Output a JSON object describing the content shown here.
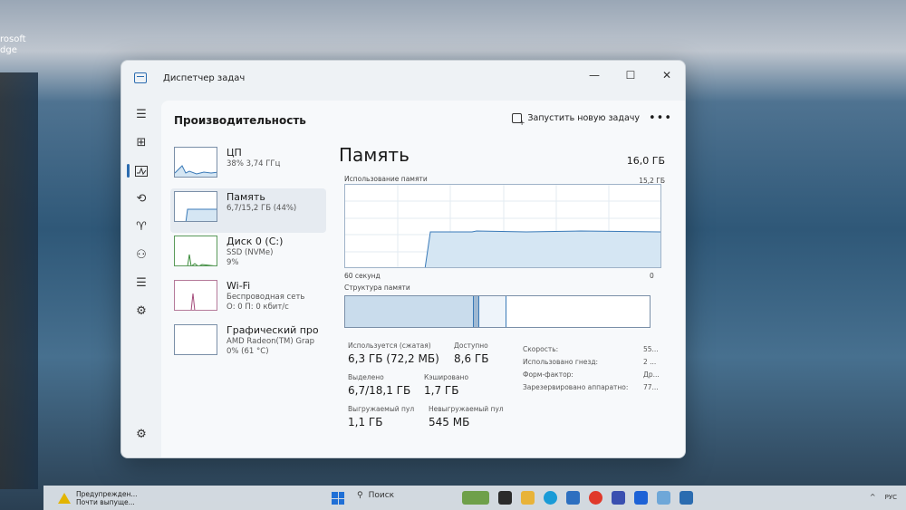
{
  "desktop": {
    "edge_label": "rosoft\ndge"
  },
  "window": {
    "title": "Диспетчер задач",
    "controls": {
      "minimize": "—",
      "maximize": "☐",
      "close": "✕"
    }
  },
  "header": {
    "section_title": "Производительность",
    "run_task_label": "Запустить новую задачу",
    "more": "•••"
  },
  "rail_icons": [
    "hamburger-icon",
    "processes-icon",
    "performance-icon",
    "history-icon",
    "startup-icon",
    "users-icon",
    "details-icon",
    "services-icon",
    "settings-icon"
  ],
  "perf_list": [
    {
      "name": "ЦП",
      "sub1": "38% 3,74 ГГц",
      "sub2": ""
    },
    {
      "name": "Память",
      "sub1": "6,7/15,2 ГБ (44%)",
      "sub2": ""
    },
    {
      "name": "Диск 0 (C:)",
      "sub1": "SSD (NVMe)",
      "sub2": "9%"
    },
    {
      "name": "Wi-Fi",
      "sub1": "Беспроводная сеть",
      "sub2": "О: 0 П: 0 кбит/с"
    },
    {
      "name": "Графический про",
      "sub1": "AMD Radeon(TM) Grap",
      "sub2": "0% (61 °C)"
    }
  ],
  "memory": {
    "title": "Память",
    "total": "16,0 ГБ",
    "usage_label": "Использование памяти",
    "usage_max": "15,2 ГБ",
    "axis_left": "60 секунд",
    "axis_right": "0",
    "structure_label": "Структура памяти",
    "stats": {
      "in_use_label": "Используется (сжатая)",
      "in_use_value": "6,3 ГБ (72,2 МБ)",
      "available_label": "Доступно",
      "available_value": "8,6 ГБ",
      "committed_label": "Выделено",
      "committed_value": "6,7/18,1 ГБ",
      "cached_label": "Кэшировано",
      "cached_value": "1,7 ГБ",
      "paged_label": "Выгружаемый пул",
      "paged_value": "1,1 ГБ",
      "nonpaged_label": "Невыгружаемый пул",
      "nonpaged_value": "545 МБ"
    },
    "props": [
      {
        "key": "Скорость:",
        "value": "55..."
      },
      {
        "key": "Использовано гнезд:",
        "value": "2 ..."
      },
      {
        "key": "Форм-фактор:",
        "value": "Др..."
      },
      {
        "key": "Зарезервировано аппаратно:",
        "value": "77..."
      }
    ]
  },
  "taskbar": {
    "notif_line1": "Предупрежден...",
    "notif_line2": "Почти выпуще...",
    "search_label": "Поиск",
    "lang": "РУС"
  },
  "colors": {
    "accent": "#2b6cb0",
    "graph_fill": "#d5e6f3",
    "graph_line": "#3a7ab8"
  }
}
